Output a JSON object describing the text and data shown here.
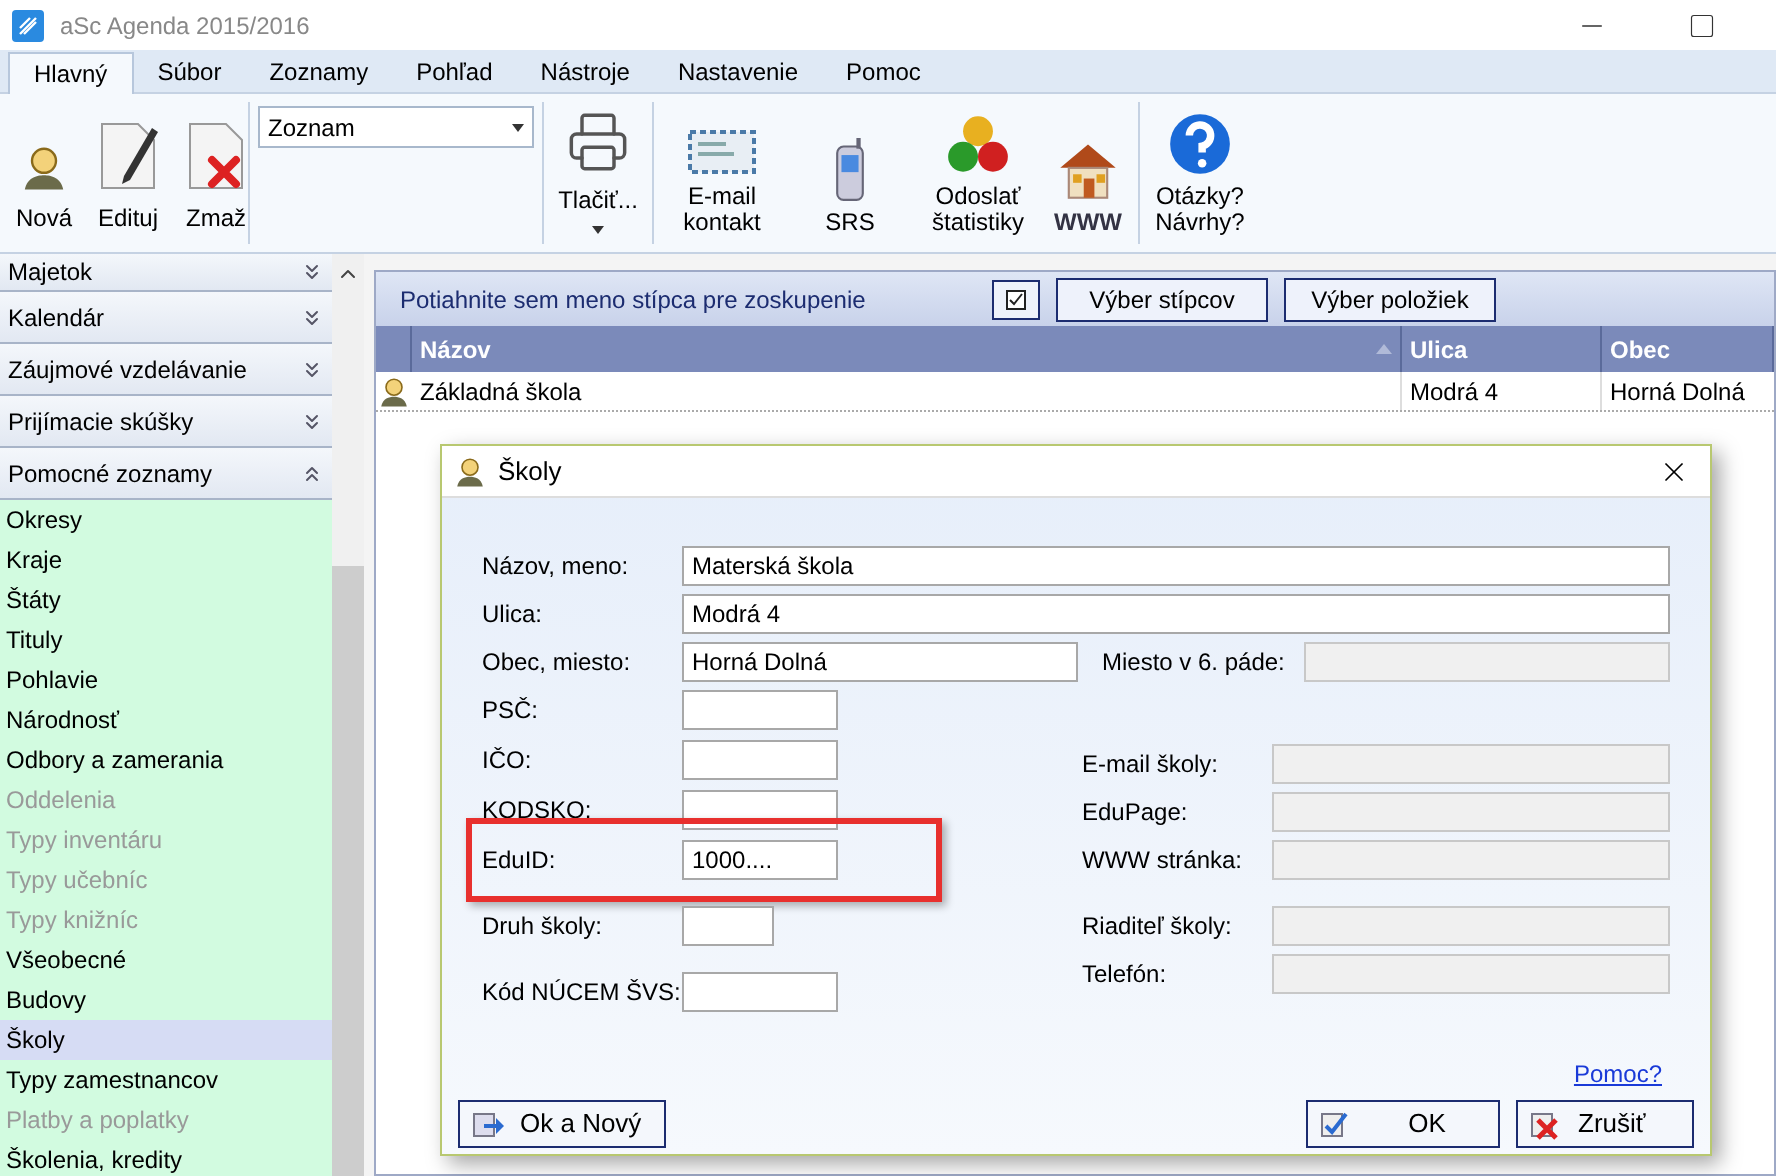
{
  "window": {
    "title": "aSc Agenda 2015/2016"
  },
  "ribbon": {
    "tabs": [
      {
        "label": "Hlavný",
        "selected": true
      },
      {
        "label": "Súbor",
        "selected": false
      },
      {
        "label": "Zoznamy",
        "selected": false
      },
      {
        "label": "Pohľad",
        "selected": false
      },
      {
        "label": "Nástroje",
        "selected": false
      },
      {
        "label": "Nastavenie",
        "selected": false
      },
      {
        "label": "Pomoc",
        "selected": false
      }
    ],
    "record_buttons": [
      {
        "label": "Nová",
        "kind": "person"
      },
      {
        "label": "Edituj",
        "kind": "edit"
      },
      {
        "label": "Zmaž",
        "kind": "delete"
      }
    ],
    "view_select": {
      "value": "Zoznam"
    },
    "print_button": {
      "label": "Tlačiť..."
    },
    "tool_buttons": [
      {
        "label": "E-mail kontakt",
        "kind": "mail"
      },
      {
        "label": "SRS",
        "kind": "phone"
      },
      {
        "label": "Odoslať štatistiky",
        "kind": "stats"
      },
      {
        "label": "WWW",
        "kind": "web"
      }
    ],
    "help_button": {
      "label": "Otázky? Návrhy?"
    }
  },
  "sidebar": {
    "sections": [
      {
        "label": "Majetok",
        "expanded": false
      },
      {
        "label": "Kalendár",
        "expanded": false
      },
      {
        "label": "Záujmové vzdelávanie",
        "expanded": false
      },
      {
        "label": "Prijímacie skúšky",
        "expanded": false
      },
      {
        "label": "Pomocné zoznamy",
        "expanded": true
      }
    ],
    "items": [
      {
        "label": "Okresy",
        "selected": false,
        "disabled": false
      },
      {
        "label": "Kraje",
        "selected": false,
        "disabled": false
      },
      {
        "label": "Štáty",
        "selected": false,
        "disabled": false
      },
      {
        "label": "Tituly",
        "selected": false,
        "disabled": false
      },
      {
        "label": "Pohlavie",
        "selected": false,
        "disabled": false
      },
      {
        "label": "Národnosť",
        "selected": false,
        "disabled": false
      },
      {
        "label": "Odbory a zamerania",
        "selected": false,
        "disabled": false
      },
      {
        "label": "Oddelenia",
        "selected": false,
        "disabled": true
      },
      {
        "label": "Typy inventáru",
        "selected": false,
        "disabled": true
      },
      {
        "label": "Typy učebníc",
        "selected": false,
        "disabled": true
      },
      {
        "label": "Typy knižníc",
        "selected": false,
        "disabled": true
      },
      {
        "label": "Všeobecné",
        "selected": false,
        "disabled": false
      },
      {
        "label": "Budovy",
        "selected": false,
        "disabled": false
      },
      {
        "label": "Školy",
        "selected": true,
        "disabled": false
      },
      {
        "label": "Typy zamestnancov",
        "selected": false,
        "disabled": false
      },
      {
        "label": "Platby a poplatky",
        "selected": false,
        "disabled": true
      },
      {
        "label": "Školenia, kredity",
        "selected": false,
        "disabled": false
      }
    ]
  },
  "grid": {
    "group_hint": "Potiahnite sem meno stípca pre zoskupenie",
    "buttons": [
      "Výber stípcov",
      "Výber položiek"
    ],
    "columns": [
      {
        "label": "Názov",
        "sorted": true
      },
      {
        "label": "Ulica",
        "sorted": false
      },
      {
        "label": "Obec",
        "sorted": false
      }
    ],
    "rows": [
      {
        "cells": [
          "Základná škola",
          "Modrá 4",
          "Horná Dolná"
        ]
      }
    ]
  },
  "dialog": {
    "title": "Školy",
    "name": {
      "label": "Názov, meno:",
      "value": "Materská škola"
    },
    "street": {
      "label": "Ulica:",
      "value": "Modrá 4"
    },
    "city": {
      "label": "Obec, miesto:",
      "value": "Horná Dolná"
    },
    "city_locative": {
      "label": "Miesto v 6. páde:",
      "disabled": true
    },
    "left_fields": [
      {
        "label": "PSČ:",
        "highlighted": false
      },
      {
        "label": "IČO:",
        "highlighted": false
      },
      {
        "label": "KODSKO:",
        "highlighted": false
      },
      {
        "label": "EduID:",
        "value": "1000....",
        "highlighted": true
      },
      {
        "label": "Druh školy:",
        "highlighted": false
      },
      {
        "label": "Kód NÚCEM ŠVS:",
        "highlighted": false
      }
    ],
    "right_fields": [
      {
        "label": "E-mail školy:",
        "disabled": true
      },
      {
        "label": "EduPage:",
        "disabled": true
      },
      {
        "label": "WWW stránka:",
        "disabled": true
      },
      {
        "label": "Riaditeľ školy:",
        "disabled": true
      },
      {
        "label": "Telefón:",
        "disabled": true
      }
    ],
    "help_link": "Pomoc?",
    "buttons": [
      {
        "label": "Ok a Nový",
        "kind": "next"
      },
      {
        "label": "OK",
        "kind": "ok"
      },
      {
        "label": "Zrušiť",
        "kind": "cancel"
      }
    ]
  }
}
